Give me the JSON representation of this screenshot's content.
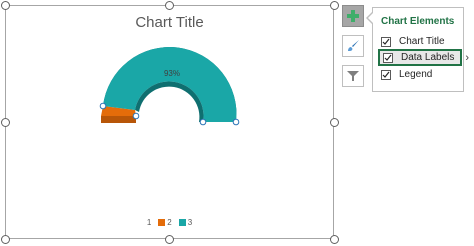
{
  "chart": {
    "title": "Chart Title",
    "data_label": "93%",
    "legend": [
      {
        "label": "1",
        "color": null
      },
      {
        "label": "2",
        "color": "#e46c0a"
      },
      {
        "label": "3",
        "color": "#1aa7a7"
      }
    ]
  },
  "chart_data": {
    "type": "pie",
    "subtype": "half-doughnut",
    "title": "Chart Title",
    "series": [
      {
        "name": "",
        "values": [
          50,
          7,
          93
        ]
      }
    ],
    "categories": [
      "1",
      "2",
      "3"
    ],
    "data_labels": [
      "93%"
    ],
    "legend_position": "bottom",
    "colors": {
      "2": "#e46c0a",
      "3": "#1aa7a7"
    }
  },
  "side_buttons": [
    {
      "name": "chart-elements",
      "icon": "plus-icon",
      "active": true
    },
    {
      "name": "chart-styles",
      "icon": "brush-icon",
      "active": false
    },
    {
      "name": "chart-filters",
      "icon": "filter-icon",
      "active": false
    }
  ],
  "panel": {
    "heading": "Chart Elements",
    "items": [
      {
        "label": "Chart Title",
        "checked": true
      },
      {
        "label": "Data Labels",
        "checked": true,
        "highlighted": true
      },
      {
        "label": "Legend",
        "checked": true
      }
    ]
  },
  "colors": {
    "accent": "#217346",
    "teal": "#1aa7a7",
    "orange": "#e46c0a"
  }
}
